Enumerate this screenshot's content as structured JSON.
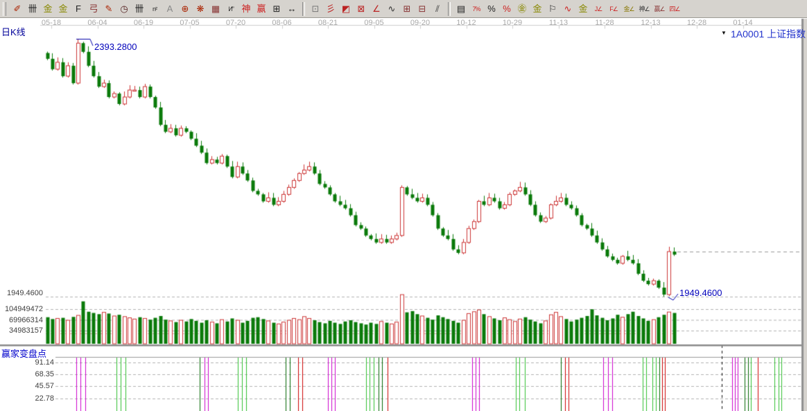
{
  "header": {
    "period_label": "日K线",
    "symbol_code": "1A0001",
    "symbol_name": "上证指数",
    "dropdown_icon": "▼"
  },
  "toolbar": {
    "groups": [
      [
        {
          "name": "draw-brush-icon",
          "glyph": "✐",
          "color": "#aa2200"
        },
        {
          "name": "grid-compress-icon",
          "glyph": "卌",
          "color": "#222222"
        },
        {
          "name": "golden-section-icon",
          "glyph": "金",
          "color": "#888800"
        },
        {
          "name": "golden-ratio-icon",
          "glyph": "金",
          "color": "#888800"
        },
        {
          "name": "fibonacci-f-icon",
          "glyph": "F",
          "color": "#222222"
        },
        {
          "name": "spiral-icon",
          "glyph": "弓",
          "color": "#883333"
        },
        {
          "name": "pen-small-icon",
          "glyph": "✎",
          "color": "#aa2200"
        },
        {
          "name": "cycle-clock-icon",
          "glyph": "◷",
          "color": "#552222"
        },
        {
          "name": "gann-grid-icon",
          "glyph": "卌",
          "color": "#222222"
        },
        {
          "name": "n-square-icon",
          "glyph": "n²",
          "color": "#222222"
        },
        {
          "name": "text-annotation-icon",
          "glyph": "A",
          "color": "#888888"
        },
        {
          "name": "compass-circle-icon",
          "glyph": "⊕",
          "color": "#aa2200"
        },
        {
          "name": "star-burst-icon",
          "glyph": "❋",
          "color": "#aa2200"
        },
        {
          "name": "web-grid-icon",
          "glyph": "▦",
          "color": "#883333"
        },
        {
          "name": "k-mark-icon",
          "glyph": "И”",
          "color": "#222222"
        },
        {
          "name": "shen-tool-icon",
          "glyph": "神",
          "color": "#cc2222"
        },
        {
          "name": "ying-tool-icon",
          "glyph": "赢",
          "color": "#cc2222"
        },
        {
          "name": "ruler-123-icon",
          "glyph": "⊞",
          "color": "#222222"
        },
        {
          "name": "width-measure-icon",
          "glyph": "↔",
          "color": "#222222"
        }
      ],
      [
        {
          "name": "window-box-icon",
          "glyph": "⊡",
          "color": "#777777"
        },
        {
          "name": "fan-lines-icon",
          "glyph": "彡",
          "color": "#bb2222"
        },
        {
          "name": "fan-area-icon",
          "glyph": "◩",
          "color": "#bb2222"
        },
        {
          "name": "cross-box-icon",
          "glyph": "⊠",
          "color": "#bb2222"
        },
        {
          "name": "angle-lines-icon",
          "glyph": "∠",
          "color": "#bb2222"
        },
        {
          "name": "zigzag-icon",
          "glyph": "∿",
          "color": "#333333"
        },
        {
          "name": "price-grid-icon",
          "glyph": "⊞",
          "color": "#883333"
        },
        {
          "name": "grid-arrow-icon",
          "glyph": "⊟",
          "color": "#883333"
        },
        {
          "name": "parallel-lines-icon",
          "glyph": "⫽",
          "color": "#333333"
        }
      ],
      [
        {
          "name": "volume-ladder-icon",
          "glyph": "▤",
          "color": "#222222"
        },
        {
          "name": "percent-strike-icon",
          "glyph": "7%",
          "color": "#cc2222"
        },
        {
          "name": "percent-icon",
          "glyph": "%",
          "color": "#222222"
        },
        {
          "name": "percent-lines-icon",
          "glyph": "%",
          "color": "#cc2222"
        },
        {
          "name": "gold-coin-icon",
          "glyph": "㊎",
          "color": "#888800"
        },
        {
          "name": "gold-lines-icon",
          "glyph": "金",
          "color": "#888800"
        },
        {
          "name": "flag-note-icon",
          "glyph": "⚐",
          "color": "#222222"
        },
        {
          "name": "wave-tool-icon",
          "glyph": "∿",
          "color": "#cc2222"
        },
        {
          "name": "gold-char-icon",
          "glyph": "金",
          "color": "#888800"
        },
        {
          "name": "j-trend-icon",
          "glyph": "J∠",
          "color": "#cc2222"
        },
        {
          "name": "f-trend-icon",
          "glyph": "F∠",
          "color": "#cc2222"
        },
        {
          "name": "gold-trend-icon",
          "glyph": "金∠",
          "color": "#887700"
        },
        {
          "name": "shen-trend-icon",
          "glyph": "神∠",
          "color": "#333333"
        },
        {
          "name": "ying-trend-icon",
          "glyph": "赢∠",
          "color": "#883333"
        },
        {
          "name": "si-trend-icon",
          "glyph": "四∠",
          "color": "#cc2222"
        }
      ]
    ]
  },
  "chart_data": {
    "type": "candlestick",
    "title": "日K线 1A0001 上证指数",
    "x_tick_labels": [
      "05-18",
      "06-04",
      "06-19",
      "07-05",
      "07-20",
      "08-06",
      "08-21",
      "09-05",
      "09-20",
      "10-12",
      "10-29",
      "11-13",
      "11-28",
      "12-13",
      "12-28",
      "01-14"
    ],
    "ylim": [
      1949.46,
      2393.28
    ],
    "high_value": 2393.28,
    "low_value": 1949.46,
    "high_annotation": "2393.2800",
    "low_annotation": "1949.4600",
    "price_axis_labels": [
      "1949.4600"
    ],
    "volume_axis_labels": [
      "104949472",
      "69966314",
      "34983157"
    ],
    "volume_axis_values": [
      104949472,
      69966314,
      34983157
    ],
    "first_open": 2370,
    "last_close": 2027.2,
    "up_color": "#cc3333",
    "down_color": "#0a7a0a",
    "closes": [
      2360,
      2342,
      2354,
      2330,
      2348,
      2318,
      2387,
      2372,
      2348,
      2330,
      2312,
      2318,
      2294,
      2300,
      2282,
      2294,
      2306,
      2306,
      2294,
      2312,
      2294,
      2276,
      2246,
      2234,
      2240,
      2228,
      2240,
      2234,
      2222,
      2210,
      2198,
      2180,
      2186,
      2180,
      2192,
      2174,
      2156,
      2174,
      2162,
      2150,
      2132,
      2126,
      2114,
      2120,
      2108,
      2114,
      2126,
      2138,
      2150,
      2162,
      2168,
      2174,
      2162,
      2144,
      2138,
      2126,
      2114,
      2108,
      2102,
      2090,
      2073,
      2067,
      2055,
      2049,
      2043,
      2049,
      2043,
      2049,
      2055,
      2138,
      2126,
      2120,
      2114,
      2120,
      2108,
      2090,
      2067,
      2055,
      2049,
      2031,
      2025,
      2043,
      2067,
      2079,
      2114,
      2108,
      2120,
      2114,
      2102,
      2108,
      2126,
      2132,
      2138,
      2126,
      2108,
      2090,
      2079,
      2085,
      2108,
      2114,
      2120,
      2108,
      2102,
      2090,
      2073,
      2067,
      2055,
      2043,
      2031,
      2019,
      2013,
      2007,
      2019,
      2013,
      2007,
      1989,
      1977,
      1971,
      1977,
      1965,
      1953,
      2027.2,
      2022
    ],
    "volumes": [
      78000000.0,
      72000000.0,
      74000000.0,
      76000000.0,
      68000000.0,
      79000000.0,
      84000000.0,
      130000000.0,
      96000000.0,
      92000000.0,
      88000000.0,
      94000000.0,
      90000000.0,
      82000000.0,
      86000000.0,
      80000000.0,
      76000000.0,
      72000000.0,
      78000000.0,
      74000000.0,
      70000000.0,
      76000000.0,
      82000000.0,
      70000000.0,
      66000000.0,
      62000000.0,
      68000000.0,
      64000000.0,
      72000000.0,
      66000000.0,
      60000000.0,
      68000000.0,
      62000000.0,
      58000000.0,
      70000000.0,
      64000000.0,
      74000000.0,
      68000000.0,
      60000000.0,
      66000000.0,
      76000000.0,
      78000000.0,
      72000000.0,
      66000000.0,
      60000000.0,
      56000000.0,
      62000000.0,
      68000000.0,
      74000000.0,
      70000000.0,
      80000000.0,
      74000000.0,
      68000000.0,
      62000000.0,
      58000000.0,
      66000000.0,
      60000000.0,
      56000000.0,
      64000000.0,
      68000000.0,
      62000000.0,
      58000000.0,
      54000000.0,
      60000000.0,
      56000000.0,
      64000000.0,
      60000000.0,
      56000000.0,
      62000000.0,
      152000000.0,
      94000000.0,
      98000000.0,
      88000000.0,
      82000000.0,
      76000000.0,
      70000000.0,
      84000000.0,
      78000000.0,
      72000000.0,
      66000000.0,
      60000000.0,
      68000000.0,
      90000000.0,
      96000000.0,
      102000000.0,
      88000000.0,
      80000000.0,
      74000000.0,
      68000000.0,
      76000000.0,
      70000000.0,
      64000000.0,
      72000000.0,
      78000000.0,
      70000000.0,
      64000000.0,
      58000000.0,
      66000000.0,
      86000000.0,
      94000000.0,
      80000000.0,
      72000000.0,
      64000000.0,
      70000000.0,
      76000000.0,
      82000000.0,
      104000000.0,
      84000000.0,
      76000000.0,
      68000000.0,
      74000000.0,
      86000000.0,
      78000000.0,
      88000000.0,
      96000000.0,
      82000000.0,
      74000000.0,
      66000000.0,
      70000000.0,
      78000000.0,
      86000000.0,
      95000000.0,
      92000000.0
    ],
    "indicator": {
      "title": "赢家变盘点",
      "tick_labels": [
        "91.14",
        "68.35",
        "45.57",
        "22.78"
      ],
      "tick_values": [
        91.14,
        68.35,
        45.57,
        22.78
      ],
      "line_colors": {
        "m": "#cc00cc",
        "g": "#2fbf2f",
        "d": "#006600",
        "r": "#cc0000"
      },
      "lines": [
        [
          110,
          "m"
        ],
        [
          116,
          "m"
        ],
        [
          123,
          "m"
        ],
        [
          168,
          "g"
        ],
        [
          174,
          "g"
        ],
        [
          181,
          "g"
        ],
        [
          288,
          "d"
        ],
        [
          295,
          "m"
        ],
        [
          300,
          "m"
        ],
        [
          343,
          "g"
        ],
        [
          349,
          "g"
        ],
        [
          355,
          "g"
        ],
        [
          412,
          "d"
        ],
        [
          418,
          "d"
        ],
        [
          430,
          "r"
        ],
        [
          436,
          "r"
        ],
        [
          473,
          "m"
        ],
        [
          478,
          "m"
        ],
        [
          483,
          "m"
        ],
        [
          528,
          "g"
        ],
        [
          533,
          "g"
        ],
        [
          539,
          "g"
        ],
        [
          546,
          "d"
        ],
        [
          551,
          "d"
        ],
        [
          559,
          "r"
        ],
        [
          681,
          "m"
        ],
        [
          686,
          "m"
        ],
        [
          691,
          "m"
        ],
        [
          744,
          "g"
        ],
        [
          749,
          "g"
        ],
        [
          757,
          "g"
        ],
        [
          809,
          "d"
        ],
        [
          815,
          "r"
        ],
        [
          820,
          "r"
        ],
        [
          870,
          "m"
        ],
        [
          877,
          "m"
        ],
        [
          883,
          "m"
        ],
        [
          927,
          "g"
        ],
        [
          932,
          "g"
        ],
        [
          941,
          "g"
        ],
        [
          946,
          "g"
        ],
        [
          951,
          "d"
        ],
        [
          955,
          "r"
        ],
        [
          959,
          "r"
        ],
        [
          1056,
          "m"
        ],
        [
          1060,
          "m"
        ],
        [
          1064,
          "m"
        ],
        [
          1074,
          "d"
        ],
        [
          1079,
          "d"
        ],
        [
          1083,
          "g"
        ],
        [
          1093,
          "r"
        ],
        [
          1117,
          "g"
        ],
        [
          1123,
          "g"
        ],
        [
          1127,
          "g"
        ]
      ]
    }
  }
}
